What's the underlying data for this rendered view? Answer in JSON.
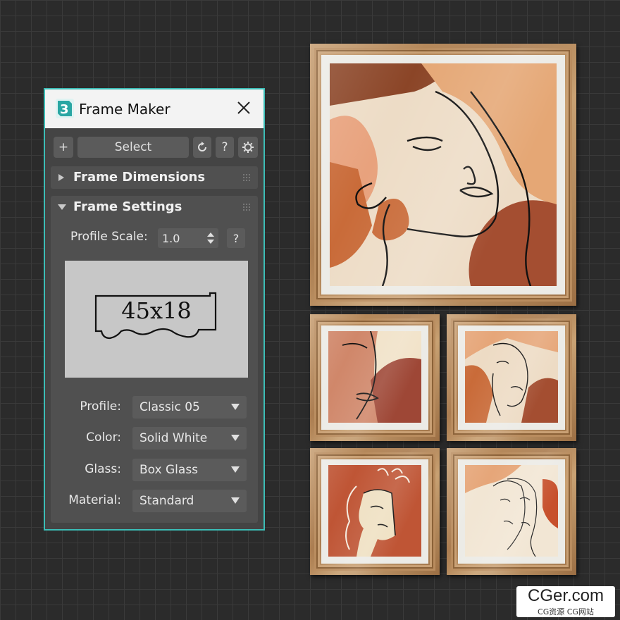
{
  "window": {
    "title": "Frame Maker",
    "app_icon": "3ds-max-icon"
  },
  "toolbar": {
    "add_label": "+",
    "select_label": "Select",
    "help_label": "?"
  },
  "rollouts": {
    "dimensions": {
      "title": "Frame Dimensions",
      "expanded": false
    },
    "settings": {
      "title": "Frame Settings",
      "expanded": true
    }
  },
  "settings": {
    "profile_scale_label": "Profile Scale:",
    "profile_scale_value": "1.0",
    "help_label": "?",
    "preview_text": "45x18",
    "fields": [
      {
        "label": "Profile:",
        "value": "Classic 05"
      },
      {
        "label": "Color:",
        "value": "Solid White"
      },
      {
        "label": "Glass:",
        "value": "Box Glass"
      },
      {
        "label": "Material:",
        "value": "Standard"
      }
    ]
  },
  "colors": {
    "panel_border": "#3bbdb6",
    "panel_bg": "#444444",
    "frame_wood": "#b58a5c"
  },
  "watermark": {
    "logo": "CGer.com",
    "subtitle": "CG资源 CG网站"
  }
}
